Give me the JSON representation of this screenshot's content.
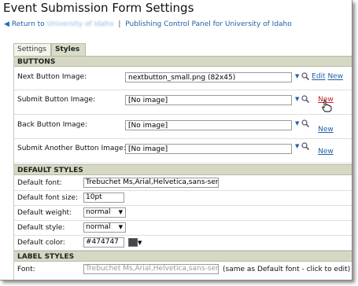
{
  "window": {
    "title": "Event Submission Form Settings"
  },
  "breadcrumb": {
    "return_label": "Return to",
    "blurred_link": "University of Idaho",
    "panel_link": "Publishing Control Panel for University of Idaho"
  },
  "tabs": [
    {
      "label": "Settings",
      "active": false
    },
    {
      "label": "Styles",
      "active": true
    }
  ],
  "sections": {
    "buttons": "BUTTONS",
    "default_styles": "DEFAULT STYLES",
    "label_styles": "LABEL STYLES"
  },
  "buttons": [
    {
      "label": "Next Button Image:",
      "value": "nextbutton_small.png (82x45)",
      "edit": "Edit",
      "new": "New"
    },
    {
      "label": "Submit Button Image:",
      "value": "[No image]",
      "new": "New"
    },
    {
      "label": "Back Button Image:",
      "value": "[No image]",
      "new": "New"
    },
    {
      "label": "Submit Another Button Image:",
      "value": "[No image]",
      "new": "New"
    }
  ],
  "default_styles": {
    "font": {
      "label": "Default font:",
      "value": "Trebuchet Ms,Arial,Helvetica,sans-serif"
    },
    "font_size": {
      "label": "Default font size:",
      "value": "10pt"
    },
    "weight": {
      "label": "Default weight:",
      "value": "normal"
    },
    "style": {
      "label": "Default style:",
      "value": "normal"
    },
    "color": {
      "label": "Default color:",
      "value": "#474747",
      "swatch": "#474747"
    }
  },
  "label_styles": {
    "font": {
      "label": "Font:",
      "value": "Trebuchet Ms,Arial,Helvetica,sans-serif",
      "note": "(same as Default font - click to edit)"
    }
  },
  "colors": {
    "accent_link": "#1f5fa8",
    "hover_link": "#cc1f1f",
    "section_bg": "#d6d8c4"
  },
  "icons": {
    "dropdown": "chevron-down-icon",
    "browse": "magnifier-icon",
    "back": "arrow-left-icon",
    "pointer": "hand-cursor-icon"
  }
}
